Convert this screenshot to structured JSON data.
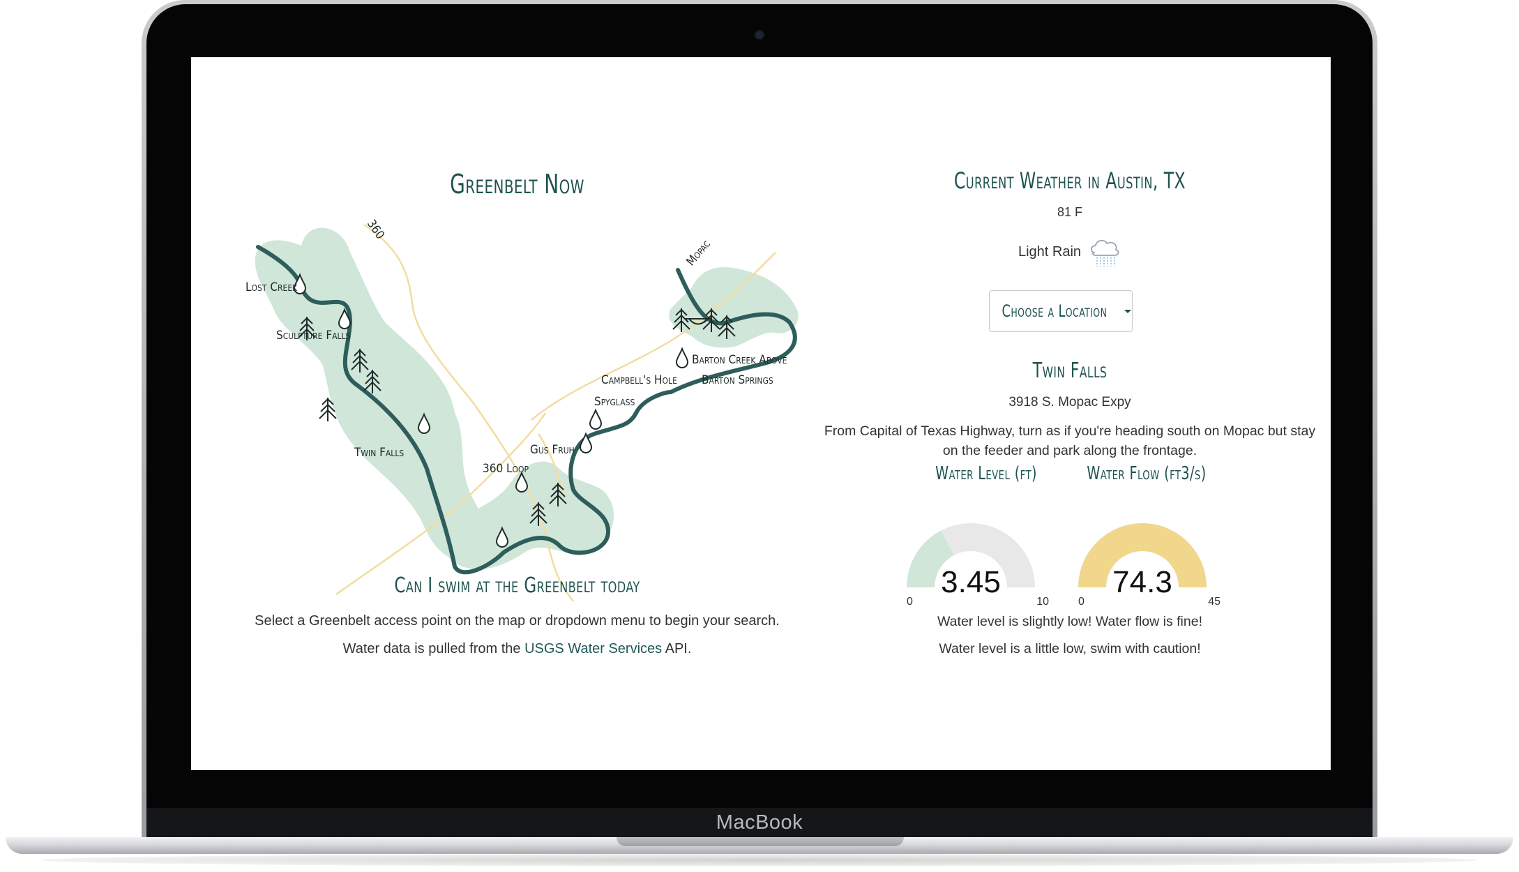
{
  "device": {
    "brand_label": "MacBook"
  },
  "left_panel": {
    "title": "Greenbelt Now",
    "map": {
      "roads": [
        "360",
        "Mopac"
      ],
      "locations": [
        "Lost Creek",
        "Sculpture Falls",
        "Twin Falls",
        "360 Loop",
        "Gus Fruh",
        "Spyglass",
        "Campbell's Hole",
        "Barton Creek Above",
        "Barton Springs"
      ],
      "icons": [
        "water-drop-icon",
        "pine-tree-icon",
        "bridge-icon"
      ],
      "colors": {
        "creek": "#2e5e5b",
        "park": "#cfe6d9",
        "road": "#f3dca0"
      }
    },
    "swim_title": "Can I swim at the Greenbelt today",
    "intro": "Select a Greenbelt access point on the map or dropdown menu to begin your search.",
    "source_prefix": "Water data is pulled from the ",
    "source_link": "USGS Water Services",
    "source_suffix": " API."
  },
  "right_panel": {
    "weather_title": "Current Weather in Austin, TX",
    "temperature": "81 F",
    "condition": "Light Rain",
    "condition_icon": "rain-cloud-icon",
    "dropdown_label": "Choose a Location",
    "location_name": "Twin Falls",
    "address": "3918 S. Mopac Expy",
    "directions": "From Capital of Texas Highway, turn as if you're heading south on Mopac but stay on the feeder and park along the frontage.",
    "gauges": [
      {
        "title": "Water Level (ft)",
        "value": "3.45",
        "min": "0",
        "max": "10",
        "fill_fraction": 0.345,
        "color": "#cfe6d9"
      },
      {
        "title": "Water Flow (ft3/s)",
        "value": "74.3",
        "min": "0",
        "max": "45",
        "fill_fraction": 1.0,
        "color": "#f0d78c"
      }
    ],
    "status_lines": [
      "Water level is slightly low! Water flow is fine!",
      "Water level is a little low, swim with caution!"
    ]
  }
}
